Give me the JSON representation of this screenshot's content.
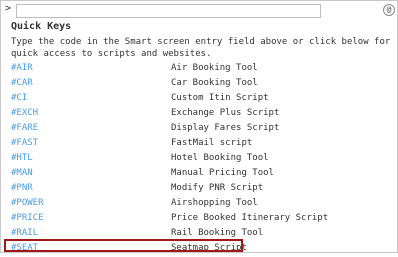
{
  "entry": {
    "prompt": ">",
    "value": "",
    "help_icon": "@"
  },
  "title": "Quick Keys",
  "intro": "Type the code in the Smart screen entry field above or click below for quick access to scripts and websites.",
  "items": [
    {
      "code": "#AIR",
      "description": "Air Booking Tool"
    },
    {
      "code": "#CAR",
      "description": "Car Booking Tool"
    },
    {
      "code": "#CI",
      "description": "Custom Itin Script"
    },
    {
      "code": "#EXCH",
      "description": "Exchange Plus Script"
    },
    {
      "code": "#FARE",
      "description": "Display Fares Script"
    },
    {
      "code": "#FAST",
      "description": "FastMail script"
    },
    {
      "code": "#HTL",
      "description": "Hotel Booking Tool"
    },
    {
      "code": "#MAN",
      "description": "Manual Pricing Tool"
    },
    {
      "code": "#PNR",
      "description": "Modify PNR Script"
    },
    {
      "code": "#POWER",
      "description": "Airshopping Tool"
    },
    {
      "code": "#PRICE",
      "description": "Price Booked Itinerary Script"
    },
    {
      "code": "#RAIL",
      "description": "Rail Booking Tool"
    },
    {
      "code": "#SEAT",
      "description": "Seatmap Script"
    }
  ],
  "highlighted_code": "#SEAT",
  "colors": {
    "link": "#4a9de0",
    "text": "#333333",
    "highlight_border": "#a01818"
  }
}
